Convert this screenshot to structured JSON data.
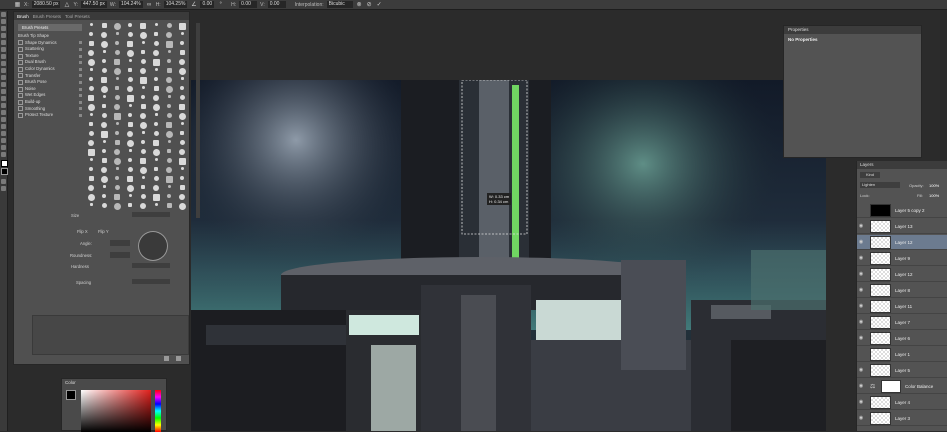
{
  "colors": {
    "bg": "#2b2b2b",
    "panel": "#535353",
    "panel_dark": "#3c3c3c",
    "selection": "#6c7b8f",
    "accent_green": "#7cf26a"
  },
  "options_bar": {
    "x_label": "X:",
    "x_value": "2080.50 px",
    "y_label": "Y:",
    "y_value": "447.50 px",
    "w_label": "W:",
    "w_value": "104.24%",
    "h_label": "H:",
    "h_value": "104.25%",
    "angle_value": "0.00",
    "hskew_label": "H:",
    "hskew_value": "0.00",
    "vskew_label": "V:",
    "vskew_value": "0.00",
    "interp_label": "Interpolation:",
    "interp_value": "Bicubic"
  },
  "brush_panel": {
    "tabs": [
      "Brush",
      "Brush Presets",
      "Tool Presets"
    ],
    "presets_button": "Brush Presets",
    "options": [
      "Brush Tip Shape",
      "Shape Dynamics",
      "Scattering",
      "Texture",
      "Dual Brush",
      "Color Dynamics",
      "Transfer",
      "Brush Pose",
      "Noise",
      "Wet Edges",
      "Build-up",
      "Smoothing",
      "Protect Texture"
    ],
    "size_label": "Size",
    "flip_x": "Flip X",
    "flip_y": "Flip Y",
    "angle_label": "Angle:",
    "roundness_label": "Roundness:",
    "hardness_label": "Hardness",
    "spacing_label": "Spacing"
  },
  "color_panel": {
    "title": "Color"
  },
  "properties": {
    "title": "Properties",
    "subtitle": "No Properties"
  },
  "transform_readout": {
    "line1": "W: 0.33 cm",
    "line2": "H: 0.34 cm"
  },
  "layers": {
    "title": "Layers",
    "kind": "Kind",
    "blend_mode": "Lighten",
    "opacity_label": "Opacity:",
    "opacity_value": "100%",
    "lock_label": "Lock:",
    "fill_label": "Fill:",
    "fill_value": "100%",
    "items": [
      "Layer 5 copy 2",
      "Layer 13",
      "Layer 12",
      "Layer 9",
      "Layer 12",
      "Layer 8",
      "Layer 11",
      "Layer 7",
      "Layer 6",
      "Layer 1",
      "Layer 5",
      "Color Balance",
      "Layer 4",
      "Layer 3"
    ]
  }
}
